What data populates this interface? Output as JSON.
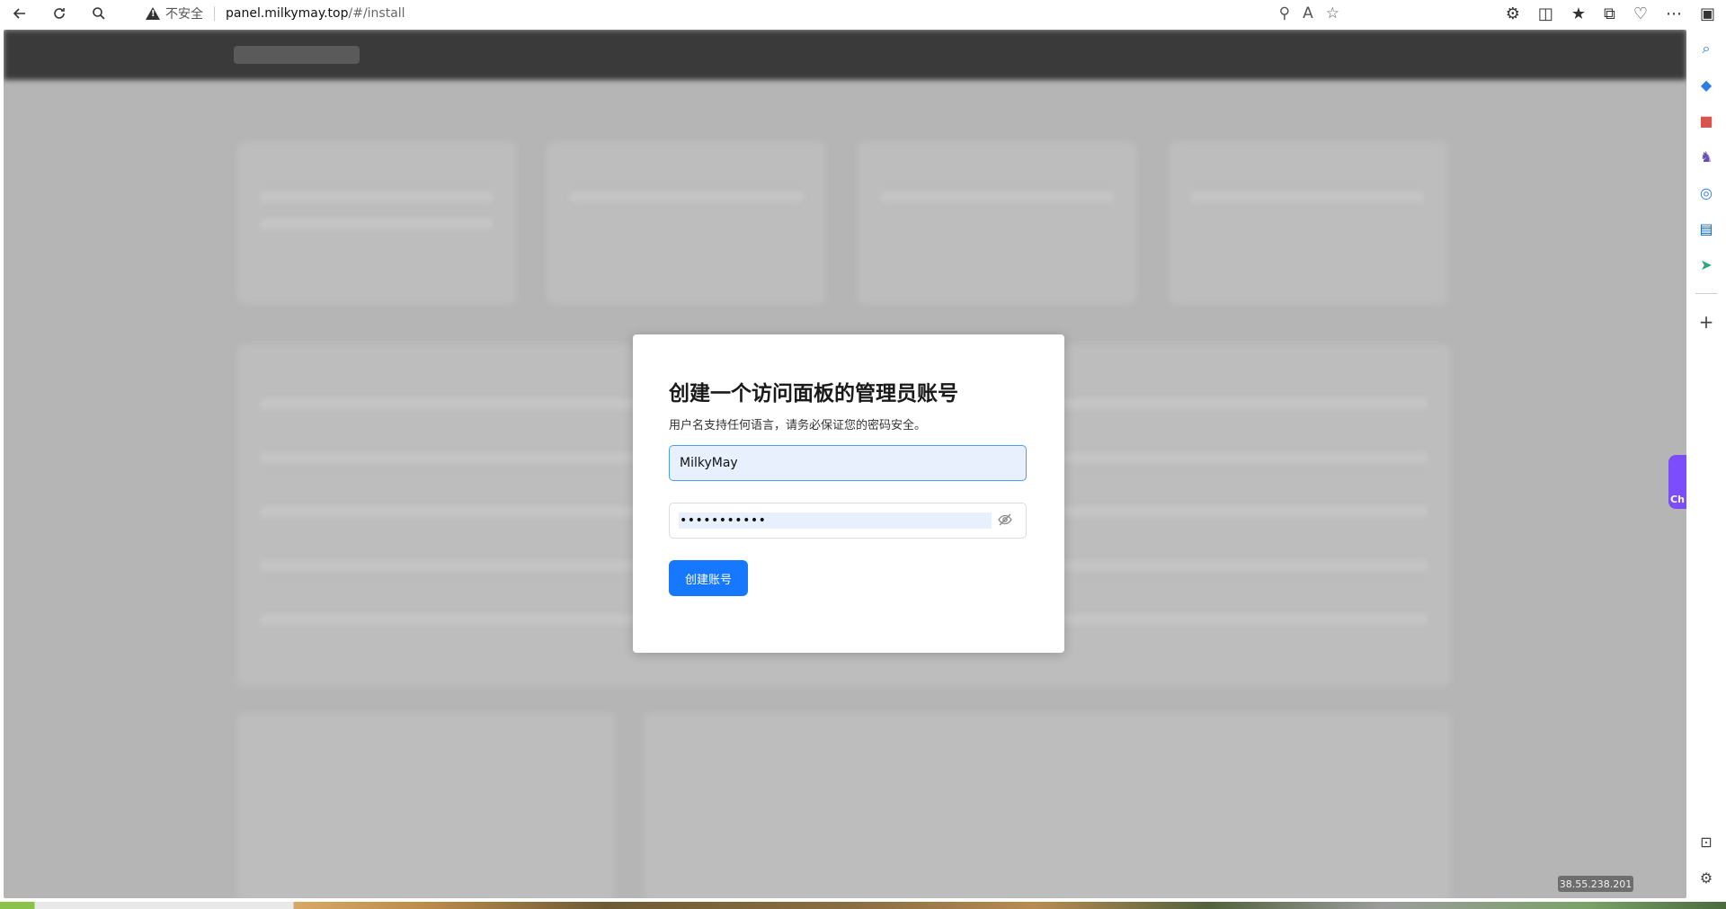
{
  "browser": {
    "security_label": "不安全",
    "url_host": "panel.milkymay.top",
    "url_path": "/#/install"
  },
  "modal": {
    "title": "创建一个访问面板的管理员账号",
    "subtitle": "用户名支持任何语言，请务必保证您的密码安全。",
    "username_value": "MilkyMay",
    "password_masked": "•••••••••••",
    "submit_label": "创建账号"
  },
  "side_tab": {
    "label": "Ch"
  },
  "ip_badge": "38.55.238.201",
  "colors": {
    "primary": "#1677ff",
    "overlay": "#b5b5b5",
    "autofill": "#e8f0fe"
  },
  "icons": {
    "back": "arrow-left-icon",
    "refresh": "refresh-icon",
    "search": "search-icon",
    "warning": "warning-icon",
    "eye_off": "eye-off-icon"
  }
}
